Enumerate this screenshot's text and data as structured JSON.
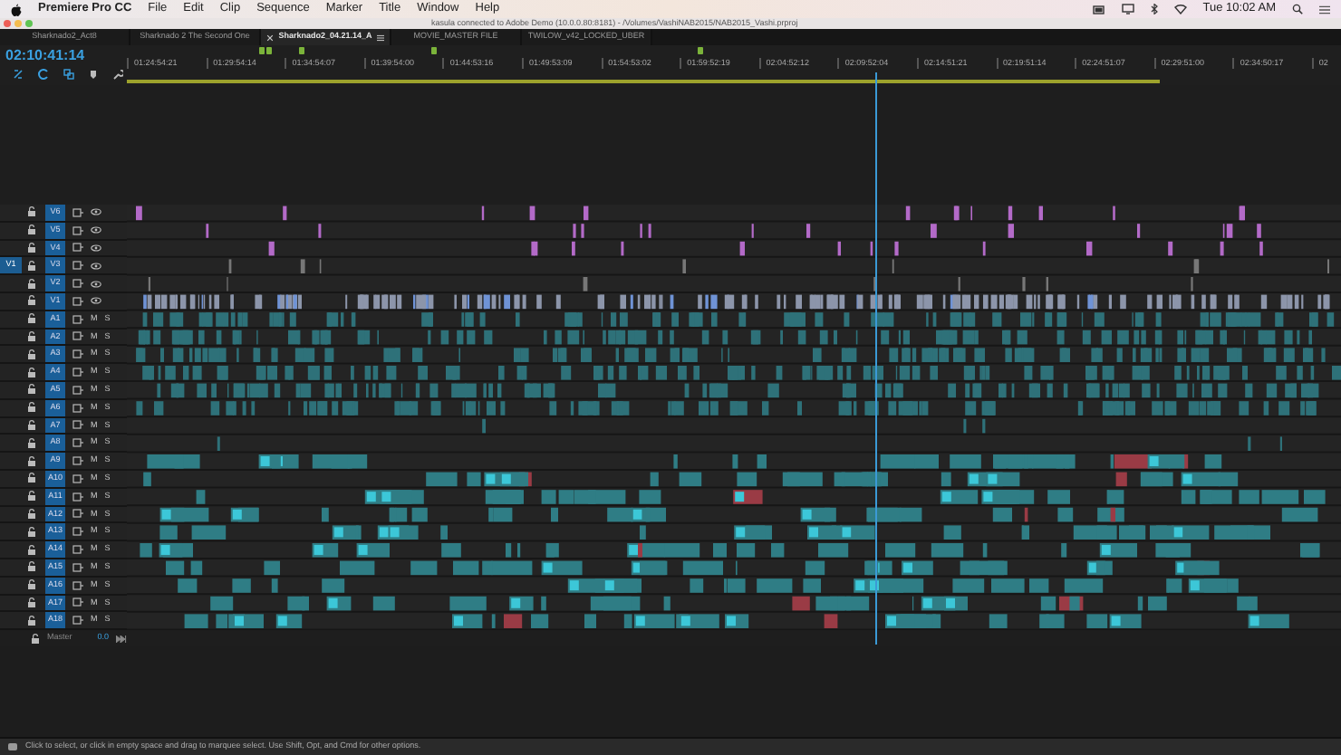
{
  "menubar": {
    "app": "Premiere Pro CC",
    "menus": [
      "File",
      "Edit",
      "Clip",
      "Sequence",
      "Marker",
      "Title",
      "Window",
      "Help"
    ],
    "clock": "Tue 10:02 AM"
  },
  "window": {
    "title": "kasula connected to Adobe Demo (10.0.0.80:8181) - /Volumes/VashiNAB2015/NAB2015_Vashi.prproj"
  },
  "tabs": [
    {
      "label": "Sharknado2_Act8",
      "selected": false
    },
    {
      "label": "Sharknado 2 The Second One",
      "selected": false
    },
    {
      "label": "Sharknado2_04.21.14_A",
      "selected": true
    },
    {
      "label": "MOVIE_MASTER FILE",
      "selected": false
    },
    {
      "label": "TWILOW_v42_LOCKED_UBER",
      "selected": false
    }
  ],
  "timeline": {
    "timecode": "02:10:41:14",
    "ruler": [
      "01:24:54:21",
      "01:29:54:14",
      "01:34:54:07",
      "01:39:54:00",
      "01:44:53:16",
      "01:49:53:09",
      "01:54:53:02",
      "01:59:52:19",
      "02:04:52:12",
      "02:09:52:04",
      "02:14:51:21",
      "02:19:51:14",
      "02:24:51:07",
      "02:29:51:00",
      "02:34:50:17",
      "02"
    ],
    "tracks": [
      {
        "name": "V6",
        "kind": "video",
        "targeted": true
      },
      {
        "name": "V5",
        "kind": "video",
        "targeted": true
      },
      {
        "name": "V4",
        "kind": "video",
        "targeted": true
      },
      {
        "name": "V3",
        "kind": "video",
        "targeted": true,
        "source": "V1"
      },
      {
        "name": "V2",
        "kind": "video",
        "targeted": true
      },
      {
        "name": "V1",
        "kind": "video",
        "targeted": true
      },
      {
        "name": "A1",
        "kind": "audio",
        "targeted": true,
        "mute": "M",
        "solo": "S"
      },
      {
        "name": "A2",
        "kind": "audio",
        "targeted": true,
        "mute": "M",
        "solo": "S"
      },
      {
        "name": "A3",
        "kind": "audio",
        "targeted": true,
        "mute": "M",
        "solo": "S"
      },
      {
        "name": "A4",
        "kind": "audio",
        "targeted": true,
        "mute": "M",
        "solo": "S"
      },
      {
        "name": "A5",
        "kind": "audio",
        "targeted": true,
        "mute": "M",
        "solo": "S"
      },
      {
        "name": "A6",
        "kind": "audio",
        "targeted": true,
        "mute": "M",
        "solo": "S"
      },
      {
        "name": "A7",
        "kind": "audio",
        "targeted": true,
        "mute": "M",
        "solo": "S"
      },
      {
        "name": "A8",
        "kind": "audio",
        "targeted": true,
        "mute": "M",
        "solo": "S"
      },
      {
        "name": "A9",
        "kind": "audio",
        "targeted": true,
        "mute": "M",
        "solo": "S"
      },
      {
        "name": "A10",
        "kind": "audio",
        "targeted": true,
        "mute": "M",
        "solo": "S"
      },
      {
        "name": "A11",
        "kind": "audio",
        "targeted": true,
        "mute": "M",
        "solo": "S"
      },
      {
        "name": "A12",
        "kind": "audio",
        "targeted": true,
        "mute": "M",
        "solo": "S"
      },
      {
        "name": "A13",
        "kind": "audio",
        "targeted": true,
        "mute": "M",
        "solo": "S"
      },
      {
        "name": "A14",
        "kind": "audio",
        "targeted": true,
        "mute": "M",
        "solo": "S"
      },
      {
        "name": "A15",
        "kind": "audio",
        "targeted": true,
        "mute": "M",
        "solo": "S"
      },
      {
        "name": "A16",
        "kind": "audio",
        "targeted": true,
        "mute": "M",
        "solo": "S"
      },
      {
        "name": "A17",
        "kind": "audio",
        "targeted": true,
        "mute": "M",
        "solo": "S"
      },
      {
        "name": "A18",
        "kind": "audio",
        "targeted": true,
        "mute": "M",
        "solo": "S"
      }
    ],
    "master": {
      "label": "Master",
      "value": "0.0"
    }
  },
  "status_bar": {
    "text": "Click to select, or click in empty space and drag to marquee select. Use Shift, Opt, and Cmd for other options."
  }
}
